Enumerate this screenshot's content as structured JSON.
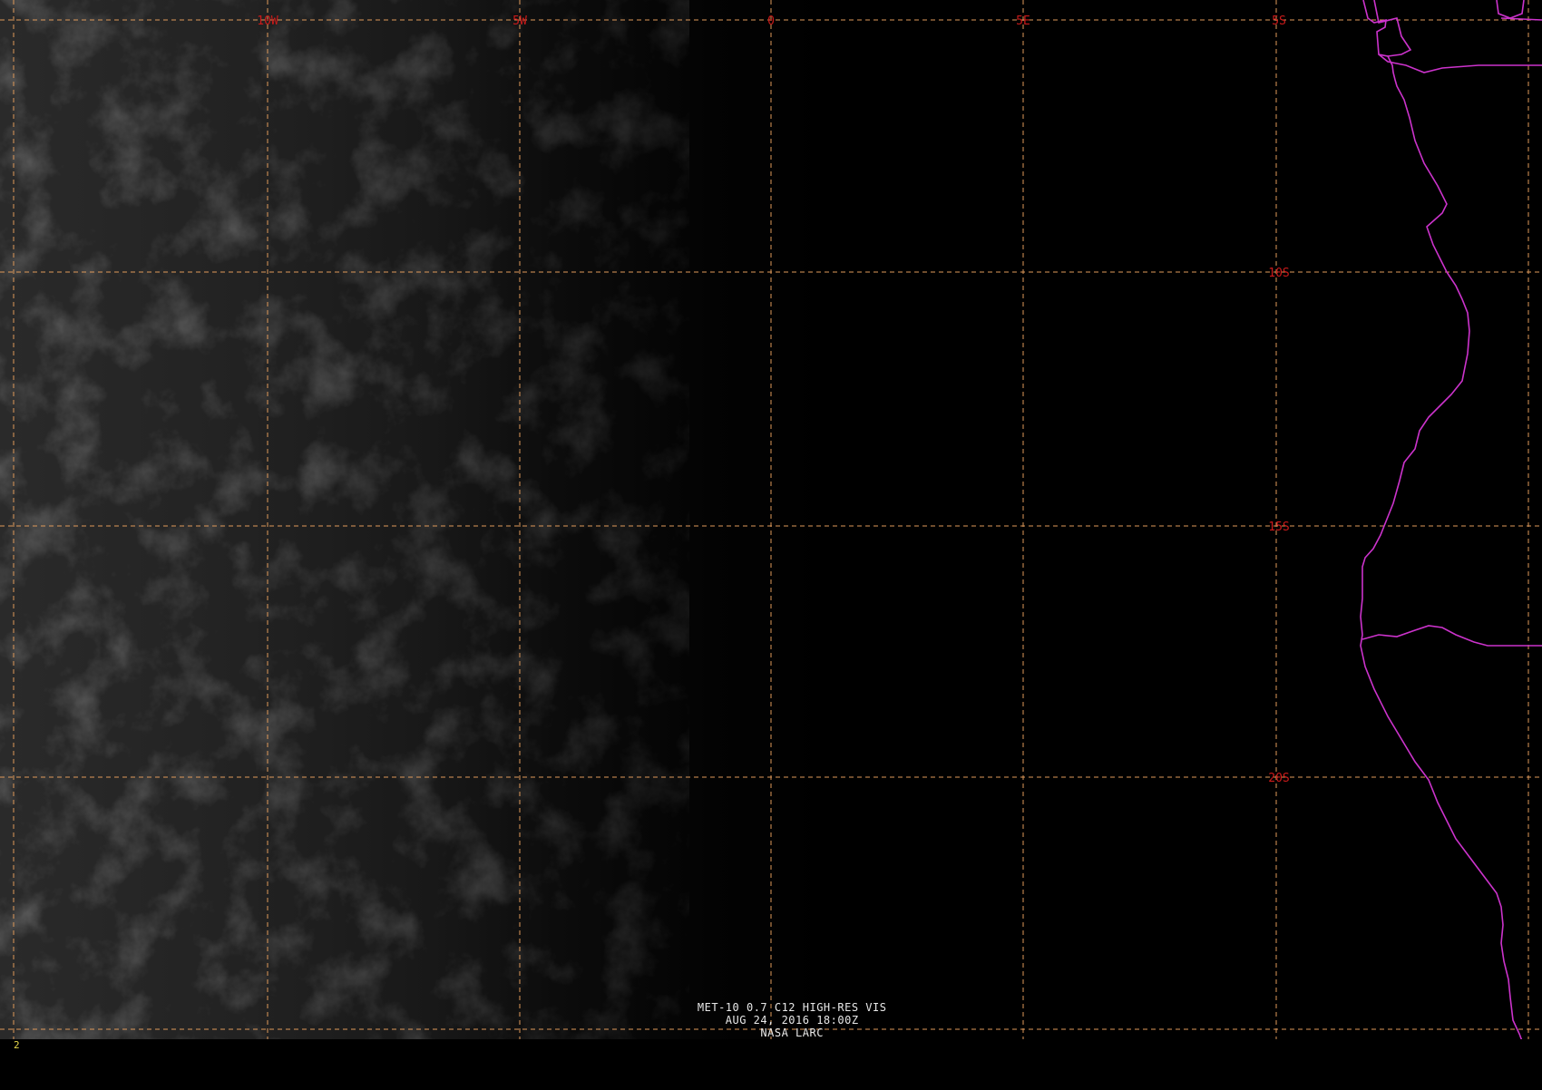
{
  "image": {
    "satellite_caption": "MET-10 0.7 C12 HIGH-RES VIS",
    "datetime": "AUG 24, 2016 18:00Z",
    "credit": "NASA LARC",
    "frame_number": "2"
  },
  "grid": {
    "longitude_labels": [
      "10W",
      "5W",
      "0",
      "5E"
    ],
    "latitude_labels": [
      "5S",
      "10S",
      "15S",
      "20S"
    ],
    "line_color": "#e09a5a",
    "label_color": "#cc1a1a"
  },
  "coastline_color": "#cc33cc",
  "background_color": "#000000"
}
